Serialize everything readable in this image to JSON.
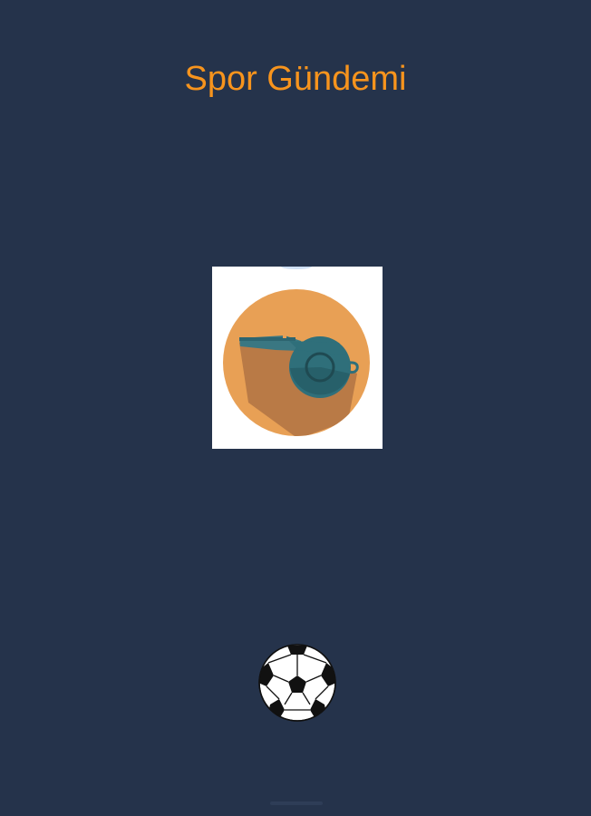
{
  "app": {
    "title": "Spor Gündemi"
  },
  "splash": {
    "logo_icon": "whistle-icon",
    "loader_icon": "soccer-ball-icon"
  },
  "colors": {
    "background": "#25334b",
    "title": "#f7941d",
    "logo_circle": "#e8a055",
    "whistle": "#2f6f7a"
  }
}
